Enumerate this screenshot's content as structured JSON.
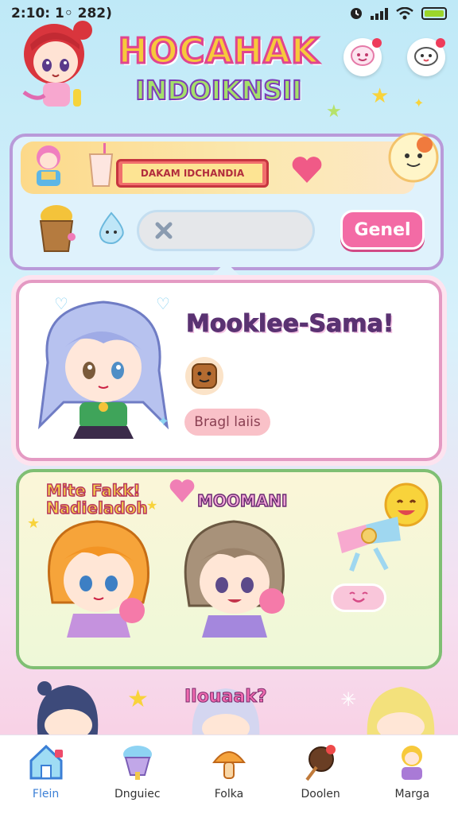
{
  "status_bar": {
    "time": "2:10: 1◦ 282)"
  },
  "header": {
    "title": "HOCAHAK",
    "subtitle": "INDOIKNSII"
  },
  "search_panel": {
    "banner_text": "DAKAM IDCHANDIA",
    "search_placeholder": "",
    "go_button_label": "Genel"
  },
  "profile_card": {
    "name": "Mooklee-Sama!",
    "tag_label": "Bragl laiis"
  },
  "featured_card": {
    "left_label_line1": "Mite Fakk!",
    "left_label_line2": "Nadieladoh",
    "right_label": "MOOMANI"
  },
  "next_row": {
    "label": "Ilouaak?"
  },
  "tabbar": {
    "tabs": [
      {
        "label": "Flein",
        "icon": "home-icon",
        "active": true
      },
      {
        "label": "Dnguiec",
        "icon": "shaved-ice-icon",
        "active": false
      },
      {
        "label": "Folka",
        "icon": "mushroom-icon",
        "active": false
      },
      {
        "label": "Doolen",
        "icon": "takoyaki-icon",
        "active": false
      },
      {
        "label": "Marga",
        "icon": "chibi-icon",
        "active": false
      }
    ]
  },
  "colors": {
    "accent_pink": "#f36ba5",
    "card_border_pink": "#e49ac3",
    "card_border_green": "#7fbf73",
    "panel_border": "#b99ad9",
    "active_tab": "#3b7fd6"
  }
}
